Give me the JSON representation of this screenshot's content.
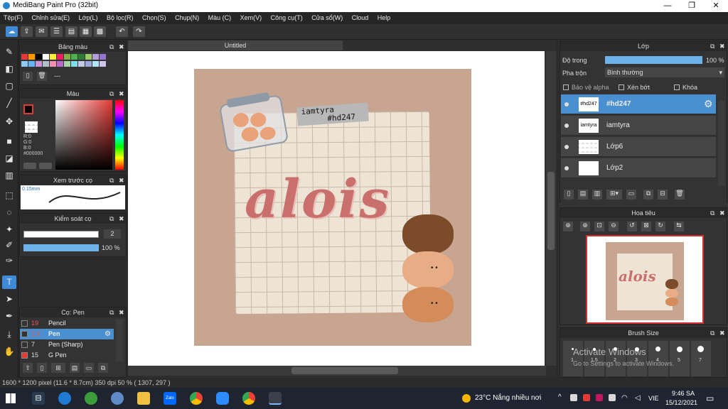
{
  "window": {
    "title": "MediBang Paint Pro (32bit)",
    "min": "—",
    "max": "❐",
    "close": "✕"
  },
  "menu": [
    "Tệp(F)",
    "Chỉnh sửa(E)",
    "Lớp(L)",
    "Bộ lọc(R)",
    "Chọn(S)",
    "Chụp(N)",
    "Màu (C)",
    "Xem(V)",
    "Công cụ(T)",
    "Cửa sổ(W)",
    "Cloud",
    "Help"
  ],
  "panels": {
    "palette_title": "Bảng màu",
    "palette_text": "---",
    "color_title": "Màu",
    "color_r": "R:0",
    "color_g": "G:0",
    "color_b": "B:0",
    "color_hex": "#000000",
    "preview_title": "Xem trước cọ",
    "preview_size": "0.15mm",
    "brushctl_title": "Kiểm soát cọ",
    "brush_size": "2",
    "brush_opacity": "100 %",
    "brush_title": "Cọ: Pen"
  },
  "brushes": [
    {
      "size": "19",
      "name": "Pencil",
      "color": "#333333"
    },
    {
      "size": "2.0",
      "name": "Pen",
      "color": "#333333"
    },
    {
      "size": "7",
      "name": "Pen (Sharp)",
      "color": "#333333"
    },
    {
      "size": "15",
      "name": "G Pen",
      "color": "#e53935"
    }
  ],
  "document": {
    "tab": "Untitled"
  },
  "art": {
    "tag1": "iamtyra",
    "tag2": "#hd247",
    "word": "alois"
  },
  "layers_panel": {
    "title": "Lớp",
    "opacity_label": "Độ trong",
    "opacity_value": "100 %",
    "blend_label": "Pha trộn",
    "blend_value": "Bình thường",
    "protect_alpha": "Bảo vệ alpha",
    "clipping": "Xén bớt",
    "lock": "Khóa"
  },
  "layers": [
    {
      "name": "#hd247",
      "thumb": "#hd247"
    },
    {
      "name": "iamtyra",
      "thumb": "iamtyra"
    },
    {
      "name": "Lớp6",
      "thumb": ""
    },
    {
      "name": "Lớp2",
      "thumb": ""
    }
  ],
  "navigator": {
    "title": "Hoa tiêu",
    "word": "alois"
  },
  "brush_size_panel": {
    "title": "Brush Size",
    "labels": [
      "1",
      "1.5",
      "2",
      "3",
      "4",
      "5",
      "7"
    ],
    "watermark1": "Activate Windows",
    "watermark2": "Go to Settings to activate Windows."
  },
  "status": {
    "text": "1600 * 1200 pixel   (11.6 * 8.7cm)   350 dpi   50 %   ( 1307, 297 )"
  },
  "taskbar": {
    "weather": "23°C  Nắng nhiều nơi",
    "lang": "VIE",
    "time": "9:46 SA",
    "date": "15/12/2021"
  },
  "colors": {
    "accent": "#4a8fd0",
    "art_bg": "#c8a591",
    "word": "#c9706d"
  }
}
